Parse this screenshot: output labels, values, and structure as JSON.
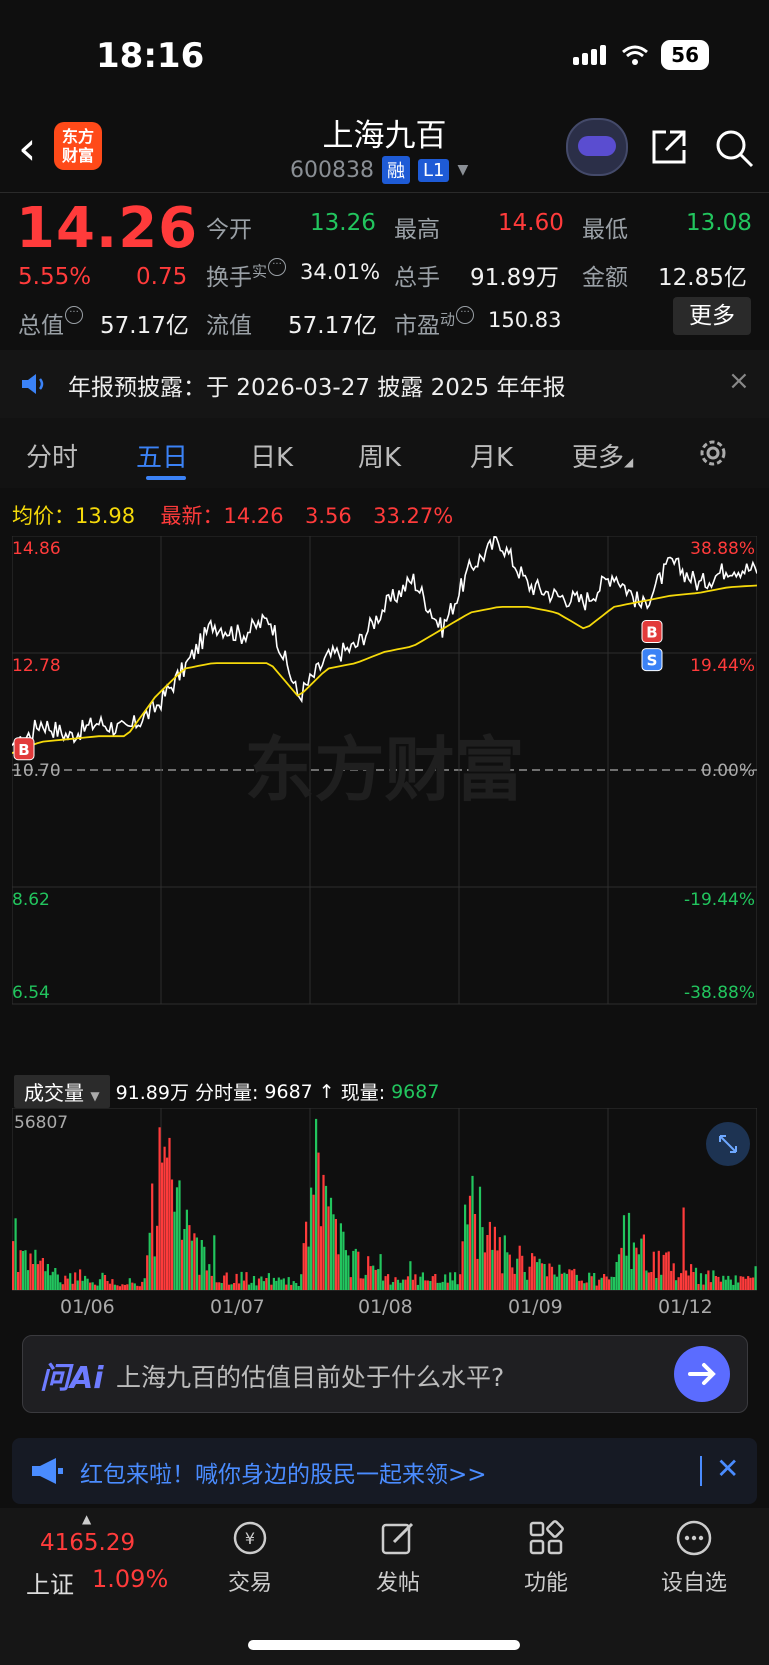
{
  "status_bar": {
    "time": "18:16",
    "battery": "56",
    "icons": [
      "signal-icon",
      "wifi-icon",
      "battery-icon"
    ]
  },
  "header": {
    "logo_line1": "东方",
    "logo_line2": "财富",
    "title": "上海九百",
    "code": "600838",
    "tag_rong": "融",
    "tag_l1": "L1"
  },
  "quote": {
    "price": "14.26",
    "change_pct": "5.55%",
    "change_val": "0.75",
    "open_label": "今开",
    "open": "13.26",
    "high_label": "最高",
    "high": "14.60",
    "low_label": "最低",
    "low": "13.08",
    "turnover_label": "换手",
    "turnover_sup": "实",
    "turnover": "34.01%",
    "volume_label": "总手",
    "volume": "91.89万",
    "amount_label": "金额",
    "amount": "12.85亿",
    "mktcap_label": "总值",
    "mktcap": "57.17亿",
    "float_label": "流值",
    "float": "57.17亿",
    "pe_label": "市盈",
    "pe_sup": "动",
    "pe": "150.83",
    "more_label": "更多"
  },
  "notice": {
    "text": "年报预披露：于 2026-03-27 披露 2025 年年报",
    "close": "×"
  },
  "tabs": {
    "items": [
      "分时",
      "五日",
      "日K",
      "周K",
      "月K",
      "更多"
    ],
    "active": "五日"
  },
  "summary": {
    "avg_label": "均价：",
    "avg": "13.98",
    "latest_label": "最新：",
    "latest": "14.26",
    "change": "3.56",
    "change_pct": "33.27%"
  },
  "chart_data": {
    "type": "line",
    "watermark": "东方财富",
    "y_ticks_left": [
      "14.86",
      "12.78",
      "10.70",
      "8.62",
      "6.54"
    ],
    "y_ticks_right": [
      "38.88%",
      "19.44%",
      "0.00%",
      "-19.44%",
      "-38.88%"
    ],
    "ylim": [
      6.54,
      14.86
    ],
    "baseline": 10.7,
    "x_dates": [
      "01/06",
      "01/07",
      "01/08",
      "01/09",
      "01/12"
    ],
    "series": [
      {
        "name": "price",
        "color": "#ffffff",
        "approx_points": [
          11.0,
          11.55,
          11.3,
          11.55,
          11.4,
          11.8,
          12.5,
          13.3,
          13.1,
          13.4,
          12.0,
          12.7,
          12.9,
          13.6,
          14.1,
          13.2,
          14.3,
          14.8,
          14.0,
          13.8,
          13.7,
          14.2,
          13.6,
          14.4,
          14.0,
          14.3,
          14.26
        ]
      },
      {
        "name": "average",
        "color": "#f5d90a",
        "approx_points": [
          11.0,
          11.2,
          11.25,
          11.3,
          11.3,
          12.0,
          12.5,
          12.6,
          12.6,
          12.6,
          12.0,
          12.5,
          12.6,
          12.8,
          12.9,
          13.2,
          13.5,
          13.6,
          13.6,
          13.5,
          13.2,
          13.6,
          13.7,
          13.8,
          13.85,
          13.95,
          13.98
        ]
      }
    ],
    "markers": [
      {
        "label": "B"
      },
      {
        "label": "B"
      },
      {
        "label": "S"
      }
    ]
  },
  "volume": {
    "label": "成交量",
    "total": "91.89万",
    "fen_label": "分时量:",
    "fen_value": "9687",
    "now_label": "现量:",
    "now_value": "9687",
    "max": "56807",
    "bars_relative": [
      0.5,
      0.3,
      0.2,
      0.15,
      0.1,
      0.12,
      0.08,
      0.1,
      0.06,
      0.07,
      0.05,
      0.9,
      1.0,
      0.6,
      0.35,
      0.2,
      0.15,
      0.12,
      0.1,
      0.09,
      0.08,
      0.08,
      0.07,
      1.0,
      0.7,
      0.45,
      0.3,
      0.2,
      0.15,
      0.12,
      0.11,
      0.1,
      0.1,
      0.1,
      0.1,
      0.75,
      0.55,
      0.4,
      0.3,
      0.25,
      0.2,
      0.18,
      0.15,
      0.12,
      0.1,
      0.1,
      0.1,
      0.55,
      0.4,
      0.3,
      0.25,
      0.2,
      0.15,
      0.12,
      0.1,
      0.08,
      0.1,
      0.15
    ]
  },
  "ai": {
    "logo": "问Ai",
    "prompt": "上海九百的估值目前处于什么水平?"
  },
  "promo": {
    "text": "红包来啦！喊你身边的股民一起来领>>",
    "close": "✕"
  },
  "bottom_nav": {
    "index_value": "4165.29",
    "index_name": "上证",
    "index_pct": "1.09%",
    "items": [
      "交易",
      "发帖",
      "功能",
      "设自选"
    ]
  }
}
